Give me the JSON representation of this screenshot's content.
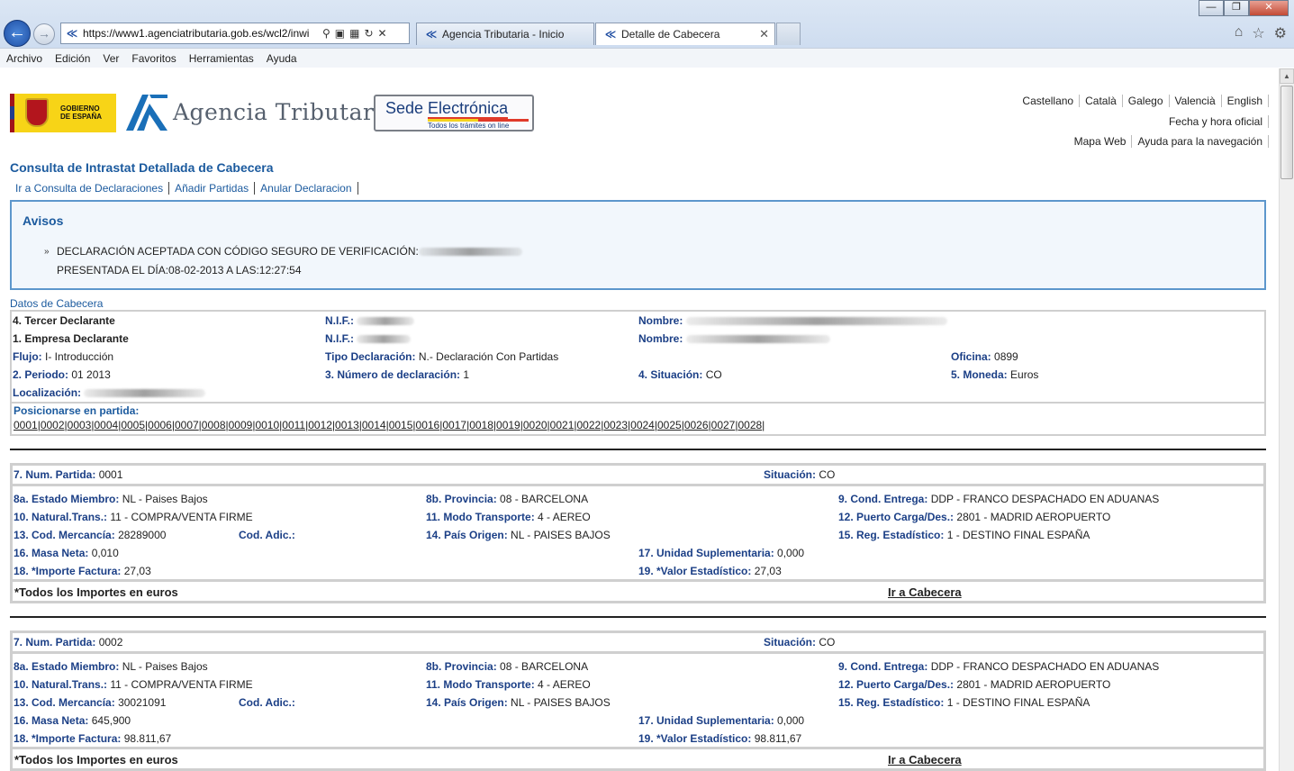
{
  "browser": {
    "url": "https://www1.agenciatributaria.gob.es/wcl2/inwi",
    "tabs": [
      {
        "label": "Agencia Tributaria - Inicio"
      },
      {
        "label": "Detalle de Cabecera"
      }
    ],
    "menu": [
      "Archivo",
      "Edición",
      "Ver",
      "Favoritos",
      "Herramientas",
      "Ayuda"
    ]
  },
  "header": {
    "gob_line1": "GOBIERNO",
    "gob_line2": "DE ESPAÑA",
    "agency": "Agencia Tributaria",
    "sede_part1": "Sede ",
    "sede_part2": "Electrónica",
    "sede_sub": "Todos los trámites on line",
    "languages": [
      "Castellano",
      "Català",
      "Galego",
      "Valencià",
      "English"
    ],
    "fecha": "Fecha y hora oficial",
    "mapa": "Mapa Web",
    "ayuda": "Ayuda para la navegación"
  },
  "page": {
    "title": "Consulta de Intrastat Detallada de Cabecera",
    "actions": [
      "Ir a Consulta de Declaraciones",
      "Añadir Partidas",
      "Anular Declaracion"
    ]
  },
  "avisos": {
    "title": "Avisos",
    "line1": "DECLARACIÓN ACEPTADA CON CÓDIGO SEGURO DE VERIFICACIÓN:",
    "line2": "PRESENTADA EL DÍA:08-02-2013 A LAS:12:27:54"
  },
  "cabecera": {
    "title": "Datos de Cabecera",
    "tercer": "4. Tercer Declarante",
    "empresa": "1. Empresa Declarante",
    "nif_label": "N.I.F.:",
    "nombre_label": "Nombre:",
    "flujo_label": "Flujo:",
    "flujo_value": "I- Introducción",
    "tipo_label": "Tipo Declaración:",
    "tipo_value": "N.- Declaración Con Partidas",
    "oficina_label": "Oficina:",
    "oficina_value": "0899",
    "periodo_label": "2. Periodo:",
    "periodo_value": "01 2013",
    "numero_label": "3. Número de declaración:",
    "numero_value": "1",
    "situacion_label": "4. Situación:",
    "situacion_value": "CO",
    "moneda_label": "5. Moneda:",
    "moneda_value": "Euros",
    "localizacion_label": "Localización:"
  },
  "posicionarse": {
    "title": "Posicionarse en partida:",
    "items": [
      "0001",
      "0002",
      "0003",
      "0004",
      "0005",
      "0006",
      "0007",
      "0008",
      "0009",
      "0010",
      "0011",
      "0012",
      "0013",
      "0014",
      "0015",
      "0016",
      "0017",
      "0018",
      "0019",
      "0020",
      "0021",
      "0022",
      "0023",
      "0024",
      "0025",
      "0026",
      "0027",
      "0028"
    ]
  },
  "labels": {
    "num_partida": "7. Num. Partida:",
    "situacion": "Situación:",
    "estado": "8a. Estado Miembro:",
    "provincia": "8b. Provincia:",
    "entrega": "9. Cond. Entrega:",
    "natural": "10. Natural.Trans.:",
    "modo": "11. Modo Transporte:",
    "puerto": "12. Puerto Carga/Des.:",
    "mercancia": "13. Cod. Mercancía:",
    "adic": "Cod. Adic.:",
    "origen": "14. País Origen:",
    "regimen": "15. Reg. Estadístico:",
    "masa": "16. Masa Neta:",
    "unidad": "17. Unidad Suplementaria:",
    "importe": "18. *Importe Factura:",
    "valor": "19. *Valor Estadístico:",
    "foot_note": "*Todos los Importes en euros",
    "foot_link": "Ir a Cabecera"
  },
  "partidas": [
    {
      "num": "0001",
      "situacion": "CO",
      "estado": "NL - Paises Bajos",
      "provincia": "08 - BARCELONA",
      "entrega": "DDP - FRANCO DESPACHADO EN ADUANAS",
      "natural": "11 - COMPRA/VENTA FIRME",
      "modo": "4 - AEREO",
      "puerto": "2801 - MADRID AEROPUERTO",
      "mercancia": "28289000",
      "adic": "",
      "origen": "NL - PAISES BAJOS",
      "regimen": "1 - DESTINO FINAL ESPAÑA",
      "masa": "0,010",
      "unidad": "0,000",
      "importe": "27,03",
      "valor": "27,03"
    },
    {
      "num": "0002",
      "situacion": "CO",
      "estado": "NL - Paises Bajos",
      "provincia": "08 - BARCELONA",
      "entrega": "DDP - FRANCO DESPACHADO EN ADUANAS",
      "natural": "11 - COMPRA/VENTA FIRME",
      "modo": "4 - AEREO",
      "puerto": "2801 - MADRID AEROPUERTO",
      "mercancia": "30021091",
      "adic": "",
      "origen": "NL - PAISES BAJOS",
      "regimen": "1 - DESTINO FINAL ESPAÑA",
      "masa": "645,900",
      "unidad": "0,000",
      "importe": "98.811,67",
      "valor": "98.811,67"
    }
  ]
}
